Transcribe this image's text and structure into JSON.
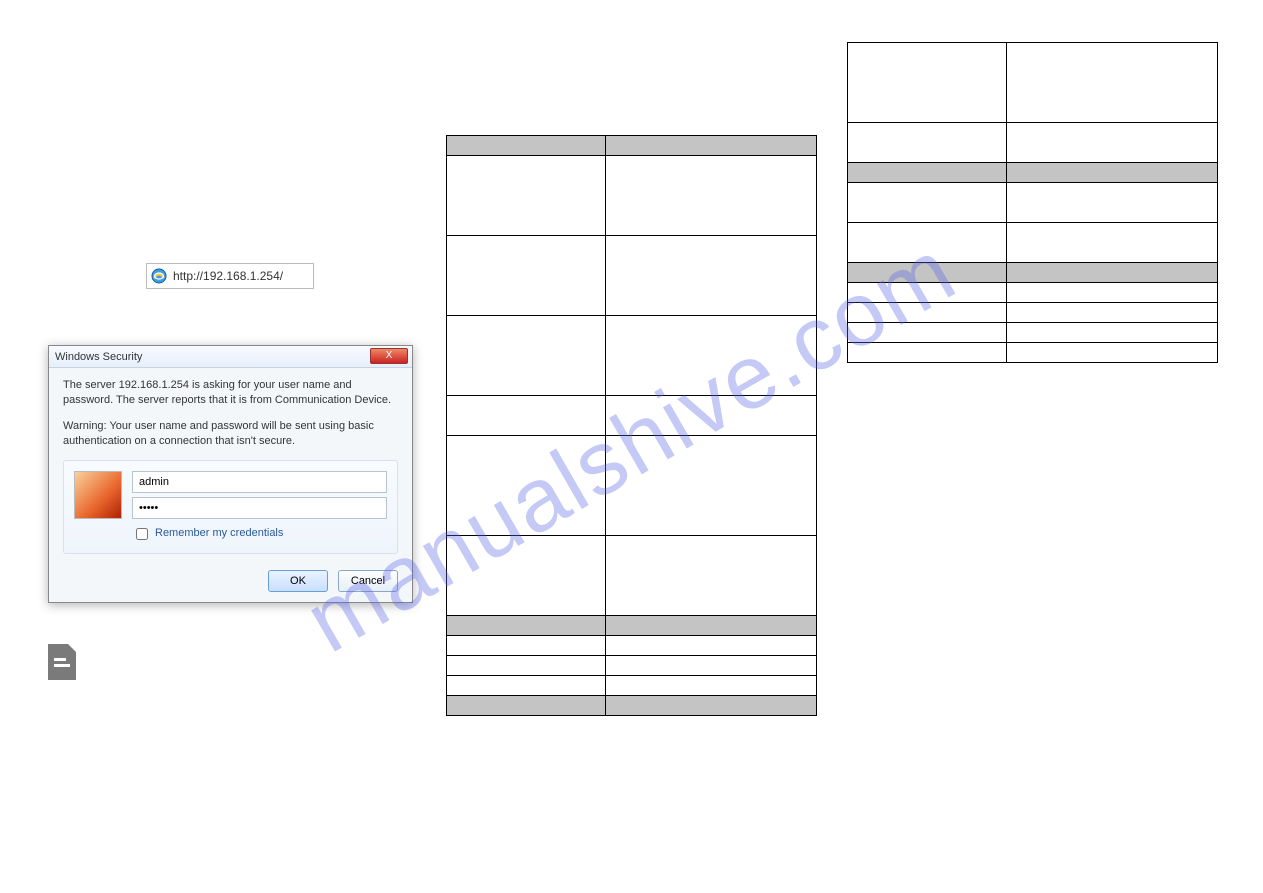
{
  "address_bar": {
    "url": "http://192.168.1.254/"
  },
  "dialog": {
    "title": "Windows Security",
    "line1": "The server 192.168.1.254 is asking for your user name and password. The server reports that it is from Communication Device.",
    "line2": "Warning: Your user name and password will be sent using basic authentication on a connection that isn't secure.",
    "username": "admin",
    "password": "•••••",
    "remember": "Remember my credentials",
    "ok": "OK",
    "cancel": "Cancel",
    "close": "X"
  },
  "watermark": "manualshive.com",
  "table1": {
    "rows": [
      {
        "cls": "hdr r-sm",
        "a": "",
        "b": ""
      },
      {
        "cls": "r-lg",
        "a": "",
        "b": ""
      },
      {
        "cls": "r-lg",
        "a": "",
        "b": ""
      },
      {
        "cls": "r-lg",
        "a": "",
        "b": ""
      },
      {
        "cls": "r-md",
        "a": "",
        "b": ""
      },
      {
        "cls": "r-xl",
        "a": "",
        "b": ""
      },
      {
        "cls": "r-lg",
        "a": "",
        "b": ""
      },
      {
        "cls": "hdr r-sm",
        "a": "",
        "b": ""
      },
      {
        "cls": "r-sm",
        "a": "",
        "b": ""
      },
      {
        "cls": "r-sm",
        "a": "",
        "b": ""
      },
      {
        "cls": "r-sm",
        "a": "",
        "b": ""
      },
      {
        "cls": "hdr r-sm",
        "a": "",
        "b": ""
      }
    ]
  },
  "table2": {
    "rows": [
      {
        "cls": "r-lg",
        "a": "",
        "b": ""
      },
      {
        "cls": "r-md",
        "a": "",
        "b": ""
      },
      {
        "cls": "hdr r-sm",
        "a": "",
        "b": ""
      },
      {
        "cls": "r-md",
        "a": "",
        "b": ""
      },
      {
        "cls": "r-md",
        "a": "",
        "b": ""
      },
      {
        "cls": "hdr r-sm",
        "a": "",
        "b": ""
      },
      {
        "cls": "r-sm",
        "a": "",
        "b": ""
      },
      {
        "cls": "r-sm",
        "a": "",
        "b": ""
      },
      {
        "cls": "r-sm",
        "a": "",
        "b": ""
      },
      {
        "cls": "r-sm",
        "a": "",
        "b": ""
      }
    ]
  }
}
